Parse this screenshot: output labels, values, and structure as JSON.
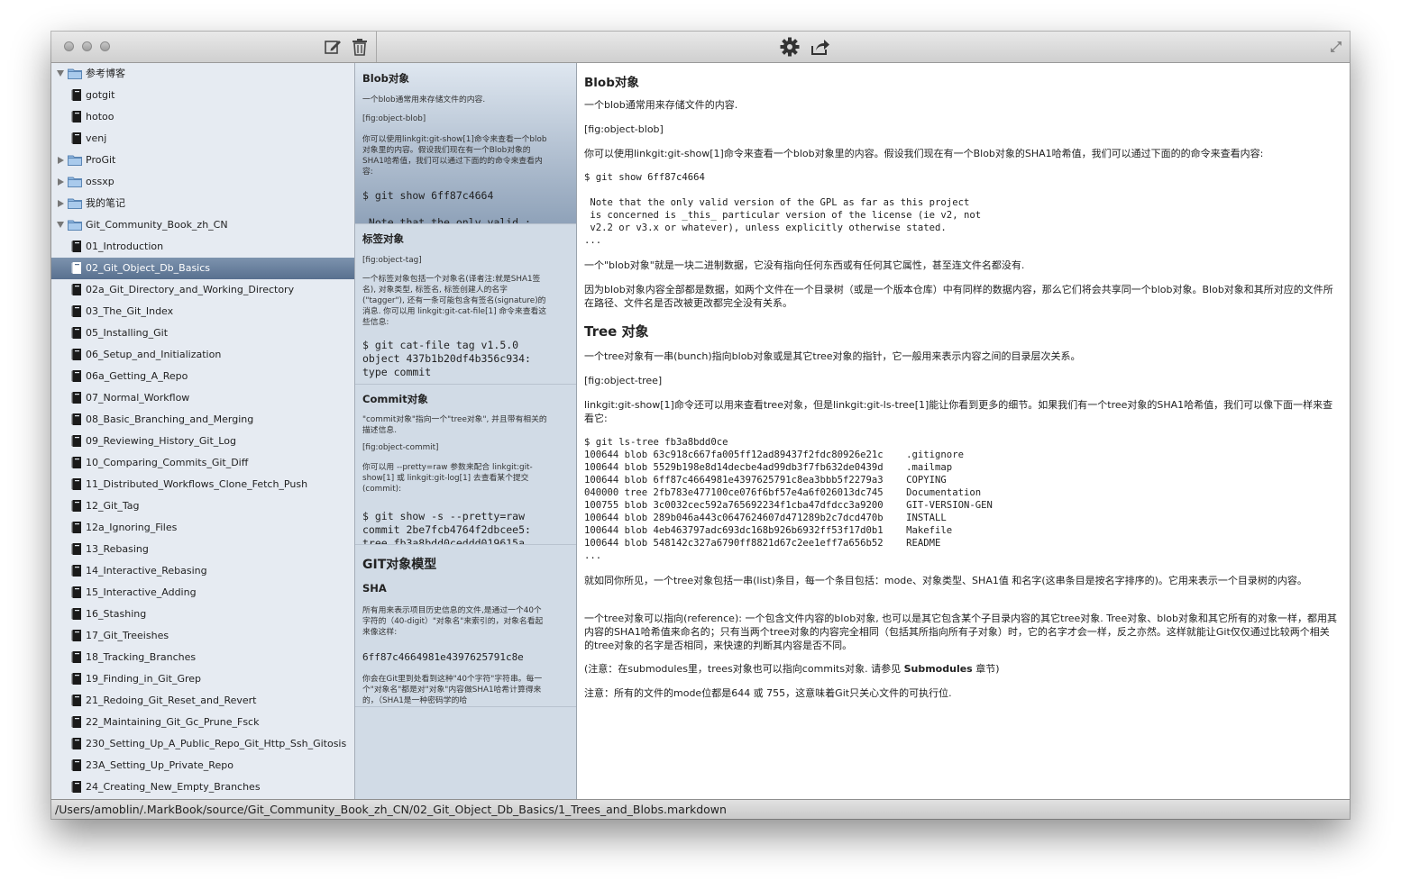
{
  "toolbar": {
    "icons": [
      "new-note-icon",
      "trash-icon",
      "gear-icon",
      "share-icon",
      "fullscreen-icon"
    ]
  },
  "sidebar": {
    "items": [
      {
        "label": "参考博客",
        "type": "folder",
        "level": 0,
        "expanded": true
      },
      {
        "label": "gotgit",
        "type": "doc",
        "level": 1
      },
      {
        "label": "hotoo",
        "type": "doc",
        "level": 1
      },
      {
        "label": "venj",
        "type": "doc",
        "level": 1
      },
      {
        "label": "ProGit",
        "type": "folder",
        "level": 0,
        "expanded": false
      },
      {
        "label": "ossxp",
        "type": "folder",
        "level": 0,
        "expanded": false
      },
      {
        "label": "我的笔记",
        "type": "folder",
        "level": 0,
        "expanded": false
      },
      {
        "label": "Git_Community_Book_zh_CN",
        "type": "folder",
        "level": 0,
        "expanded": true
      },
      {
        "label": "01_Introduction",
        "type": "doc",
        "level": 1
      },
      {
        "label": "02_Git_Object_Db_Basics",
        "type": "doc",
        "level": 1,
        "selected": true
      },
      {
        "label": "02a_Git_Directory_and_Working_Directory",
        "type": "doc",
        "level": 1
      },
      {
        "label": "03_The_Git_Index",
        "type": "doc",
        "level": 1
      },
      {
        "label": "05_Installing_Git",
        "type": "doc",
        "level": 1
      },
      {
        "label": "06_Setup_and_Initialization",
        "type": "doc",
        "level": 1
      },
      {
        "label": "06a_Getting_A_Repo",
        "type": "doc",
        "level": 1
      },
      {
        "label": "07_Normal_Workflow",
        "type": "doc",
        "level": 1
      },
      {
        "label": "08_Basic_Branching_and_Merging",
        "type": "doc",
        "level": 1
      },
      {
        "label": "09_Reviewing_History_Git_Log",
        "type": "doc",
        "level": 1
      },
      {
        "label": "10_Comparing_Commits_Git_Diff",
        "type": "doc",
        "level": 1
      },
      {
        "label": "11_Distributed_Workflows_Clone_Fetch_Push",
        "type": "doc",
        "level": 1
      },
      {
        "label": "12_Git_Tag",
        "type": "doc",
        "level": 1
      },
      {
        "label": "12a_Ignoring_Files",
        "type": "doc",
        "level": 1
      },
      {
        "label": "13_Rebasing",
        "type": "doc",
        "level": 1
      },
      {
        "label": "14_Interactive_Rebasing",
        "type": "doc",
        "level": 1
      },
      {
        "label": "15_Interactive_Adding",
        "type": "doc",
        "level": 1
      },
      {
        "label": "16_Stashing",
        "type": "doc",
        "level": 1
      },
      {
        "label": "17_Git_Treeishes",
        "type": "doc",
        "level": 1
      },
      {
        "label": "18_Tracking_Branches",
        "type": "doc",
        "level": 1
      },
      {
        "label": "19_Finding_in_Git_Grep",
        "type": "doc",
        "level": 1
      },
      {
        "label": "21_Redoing_Git_Reset_and_Revert",
        "type": "doc",
        "level": 1
      },
      {
        "label": "22_Maintaining_Git_Gc_Prune_Fsck",
        "type": "doc",
        "level": 1
      },
      {
        "label": "230_Setting_Up_A_Public_Repo_Git_Http_Ssh_Gitosis",
        "type": "doc",
        "level": 1
      },
      {
        "label": "23A_Setting_Up_Private_Repo",
        "type": "doc",
        "level": 1
      },
      {
        "label": "24_Creating_New_Empty_Branches",
        "type": "doc",
        "level": 1
      }
    ]
  },
  "previews": [
    {
      "title": "Blob对象",
      "p1": "一个blob通常用来存储文件的内容.",
      "p2": "[fig:object-blob]",
      "p3": "你可以使用linkgit:git-show[1]命令来查看一个blob对象里的内容。假设我们现在有一个Blob对象的SHA1哈希值，我们可以通过下面的的命令来查看内容:",
      "code": "$ git show 6ff87c4664\n\n Note that the only valid :"
    },
    {
      "title": "标签对象",
      "p1": "[fig:object-tag]",
      "p2": "一个标签对象包括一个对象名(译者注:就是SHA1签名), 对象类型, 标签名, 标签创建人的名字(\"tagger\"), 还有一条可能包含有签名(signature)的消息. 你可以用 linkgit:git-cat-file[1] 命令来查看这些信息:",
      "code": "$ git cat-file tag v1.5.0\nobject 437b1b20df4b356c934:\ntype commit"
    },
    {
      "title": "Commit对象",
      "p1": "\"commit对象\"指向一个\"tree对象\", 并且带有相关的描述信息.",
      "p2": "[fig:object-commit]",
      "p3": "你可以用 --pretty=raw 参数来配合 linkgit:git-show[1] 或 linkgit:git-log[1] 去查看某个提交(commit):",
      "code": "$ git show -s --pretty=raw\ncommit 2be7fcb4764f2dbcee5:\ntree fb3a8bdd0ceddd019615a"
    },
    {
      "title": "GIT对象模型",
      "sub": "SHA",
      "p1": "所有用来表示项目历史信息的文件,是通过一个40个字符的（40-digit）\"对象名\"来索引的，对象名看起来像这样:",
      "code": "6ff87c4664981e4397625791c8e",
      "p2": "你会在Git里到处看到这种\"40个字符\"字符串。每一个\"对象名\"都是对\"对象\"内容做SHA1哈希计算得来的，（SHA1是一种密码学的哈"
    }
  ],
  "content": {
    "h1": "Blob对象",
    "p1": "一个blob通常用来存储文件的内容.",
    "p2": "[fig:object-blob]",
    "p3": "你可以使用linkgit:git-show[1]命令来查看一个blob对象里的内容。假设我们现在有一个Blob对象的SHA1哈希值，我们可以通过下面的的命令来查看内容:",
    "code1": "$ git show 6ff87c4664\n\n Note that the only valid version of the GPL as far as this project\n is concerned is _this_ particular version of the license (ie v2, not\n v2.2 or v3.x or whatever), unless explicitly otherwise stated.\n...",
    "p4": "一个\"blob对象\"就是一块二进制数据，它没有指向任何东西或有任何其它属性，甚至连文件名都没有.",
    "p5": "因为blob对象内容全部都是数据，如两个文件在一个目录树（或是一个版本仓库）中有同样的数据内容，那么它们将会共享同一个blob对象。Blob对象和其所对应的文件所在路径、文件名是否改被更改都完全没有关系。",
    "h2": "Tree 对象",
    "p6": "一个tree对象有一串(bunch)指向blob对象或是其它tree对象的指针，它一般用来表示内容之间的目录层次关系。",
    "p7": "[fig:object-tree]",
    "p8": "linkgit:git-show[1]命令还可以用来查看tree对象，但是linkgit:git-ls-tree[1]能让你看到更多的细节。如果我们有一个tree对象的SHA1哈希值，我们可以像下面一样来查看它:",
    "code2": "$ git ls-tree fb3a8bdd0ce\n100644 blob 63c918c667fa005ff12ad89437f2fdc80926e21c    .gitignore\n100644 blob 5529b198e8d14decbe4ad99db3f7fb632de0439d    .mailmap\n100644 blob 6ff87c4664981e4397625791c8ea3bbb5f2279a3    COPYING\n040000 tree 2fb783e477100ce076f6bf57e4a6f026013dc745    Documentation\n100755 blob 3c0032cec592a765692234f1cba47dfdcc3a9200    GIT-VERSION-GEN\n100644 blob 289b046a443c0647624607d471289b2c7dcd470b    INSTALL\n100644 blob 4eb463797adc693dc168b926b6932ff53f17d0b1    Makefile\n100644 blob 548142c327a6790ff8821d67c2ee1eff7a656b52    README\n...",
    "p9": "就如同你所见，一个tree对象包括一串(list)条目，每一个条目包括：mode、对象类型、SHA1值 和名字(这串条目是按名字排序的)。它用来表示一个目录树的内容。",
    "p10": "一个tree对象可以指向(reference): 一个包含文件内容的blob对象, 也可以是其它包含某个子目录内容的其它tree对象. Tree对象、blob对象和其它所有的对象一样，都用其内容的SHA1哈希值来命名的；只有当两个tree对象的内容完全相同（包括其所指向所有子对象）时，它的名字才会一样，反之亦然。这样就能让Git仅仅通过比较两个相关的tree对象的名字是否相同，来快速的判断其内容是否不同。",
    "p11_pre": "(注意：在submodules里，trees对象也可以指向commits对象. 请参见 ",
    "p11_bold": "Submodules",
    "p11_post": " 章节)",
    "p12": "注意：所有的文件的mode位都是644 或 755，这意味着Git只关心文件的可执行位."
  },
  "statusbar": {
    "path": "/Users/amoblin/.MarkBook/source/Git_Community_Book_zh_CN/02_Git_Object_Db_Basics/1_Trees_and_Blobs.markdown"
  }
}
